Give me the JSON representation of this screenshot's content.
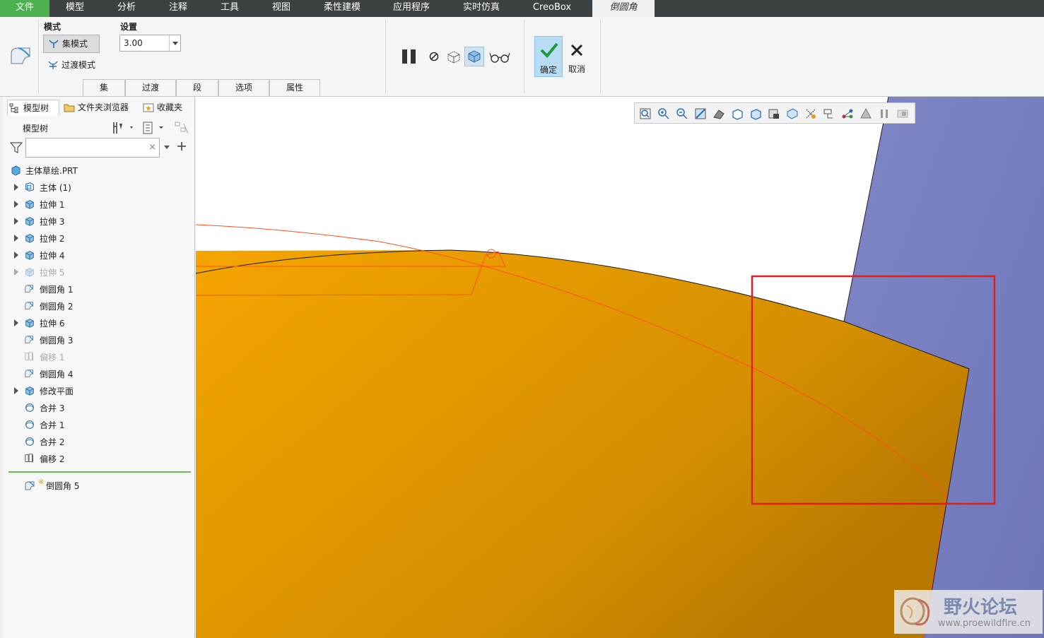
{
  "menu": {
    "tabs": [
      "文件",
      "模型",
      "分析",
      "注释",
      "工具",
      "视图",
      "柔性建模",
      "应用程序",
      "实时仿真",
      "CreoBox",
      "倒圆角"
    ]
  },
  "ribbon": {
    "mode_label": "模式",
    "set_mode": "集模式",
    "transition_mode": "过渡模式",
    "settings_label": "设置",
    "radius_value": "3.00",
    "subtabs": [
      "集",
      "过渡",
      "段",
      "选项",
      "属性"
    ],
    "ok_label": "确定",
    "cancel_label": "取消"
  },
  "left_panel": {
    "tabs": [
      "模型树",
      "文件夹浏览器",
      "收藏夹"
    ],
    "tree_header": "模型树",
    "filter_placeholder": "",
    "root": "主体草绘.PRT",
    "items": [
      {
        "label": "主体 (1)",
        "expandable": true,
        "dim": false,
        "icon": "body-icon"
      },
      {
        "label": "拉伸 1",
        "expandable": true,
        "dim": false,
        "icon": "extrude-icon"
      },
      {
        "label": "拉伸 3",
        "expandable": true,
        "dim": false,
        "icon": "extrude-icon"
      },
      {
        "label": "拉伸 2",
        "expandable": true,
        "dim": false,
        "icon": "extrude-icon"
      },
      {
        "label": "拉伸 4",
        "expandable": true,
        "dim": false,
        "icon": "extrude-icon"
      },
      {
        "label": "拉伸 5",
        "expandable": true,
        "dim": true,
        "icon": "extrude-icon"
      },
      {
        "label": "倒圆角 1",
        "expandable": false,
        "dim": false,
        "icon": "round-icon"
      },
      {
        "label": "倒圆角 2",
        "expandable": false,
        "dim": false,
        "icon": "round-icon"
      },
      {
        "label": "拉伸 6",
        "expandable": true,
        "dim": false,
        "icon": "extrude-icon"
      },
      {
        "label": "倒圆角 3",
        "expandable": false,
        "dim": false,
        "icon": "round-icon"
      },
      {
        "label": "偏移 1",
        "expandable": false,
        "dim": true,
        "icon": "offset-icon"
      },
      {
        "label": "倒圆角 4",
        "expandable": false,
        "dim": false,
        "icon": "round-icon"
      },
      {
        "label": "修改平面",
        "expandable": true,
        "dim": false,
        "icon": "extrude-icon"
      },
      {
        "label": "合并 3",
        "expandable": false,
        "dim": false,
        "icon": "merge-icon"
      },
      {
        "label": "合并 1",
        "expandable": false,
        "dim": false,
        "icon": "merge-icon"
      },
      {
        "label": "合并 2",
        "expandable": false,
        "dim": false,
        "icon": "merge-icon"
      },
      {
        "label": "偏移 2",
        "expandable": false,
        "dim": false,
        "icon": "offset-icon"
      }
    ],
    "active_feature": "倒圆角 5"
  },
  "watermark": {
    "title": "野火论坛",
    "url": "www.proewildfire.cn"
  },
  "colors": {
    "model_orange": "#f0a000",
    "plane_blue": "#7a80c0",
    "highlight_red": "#e02020",
    "file_tab_green": "#4caf50"
  }
}
